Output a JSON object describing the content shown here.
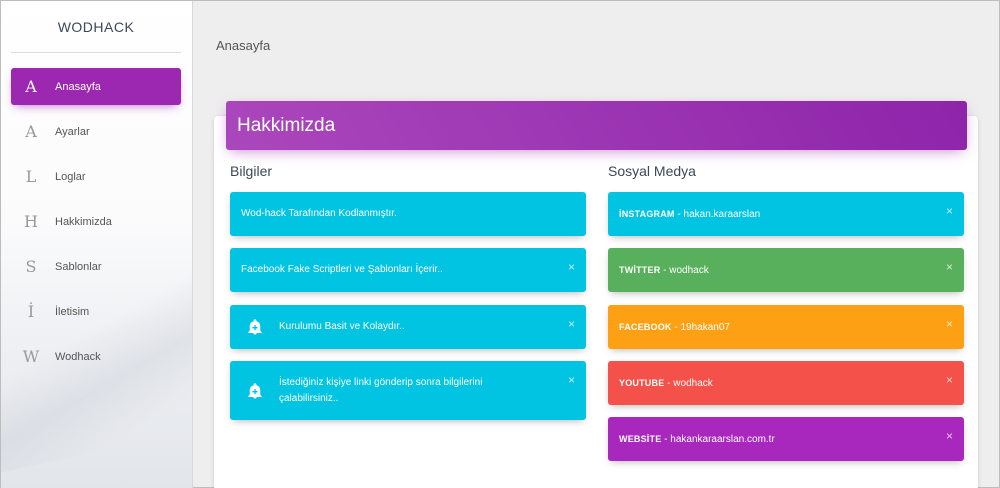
{
  "sidebar": {
    "logo": "WODHACK",
    "items": [
      {
        "mini": "A",
        "label": "Anasayfa",
        "active": true
      },
      {
        "mini": "A",
        "label": "Ayarlar"
      },
      {
        "mini": "L",
        "label": "Loglar"
      },
      {
        "mini": "H",
        "label": "Hakkimizda"
      },
      {
        "mini": "S",
        "label": "Sablonlar"
      },
      {
        "mini": "İ",
        "label": "İletisim"
      },
      {
        "mini": "W",
        "label": "Wodhack"
      }
    ]
  },
  "header": {
    "title": "Anasayfa"
  },
  "card": {
    "title": "Hakkimizda",
    "left": {
      "title": "Bilgiler",
      "alerts": [
        {
          "text": "Wod-hack Tarafından Kodlanmıştır."
        },
        {
          "text": "Facebook Fake Scriptleri ve Şablonları İçerir..",
          "close": "×"
        },
        {
          "text": "Kurulumu Basit ve Kolaydır..",
          "close": "×",
          "icon": "bell-plus-icon"
        },
        {
          "text": "İstediğiniz kişiye linki gönderip sonra bilgilerini çalabilirsiniz..",
          "close": "×",
          "icon": "bell-plus-icon"
        }
      ]
    },
    "right": {
      "title": "Sosyal Medya",
      "alerts": [
        {
          "label": "İNSTAGRAM",
          "value": " - hakan.karaarslan",
          "close": "×",
          "color": "#00c4e2"
        },
        {
          "label": "TWİTTER",
          "value": " - wodhack",
          "close": "×",
          "color": "#58b05c"
        },
        {
          "label": "FACEBOOK",
          "value": " - 19hakan07",
          "close": "×",
          "color": "#fea013"
        },
        {
          "label": "YOUTUBE",
          "value": " - wodhack",
          "close": "×",
          "color": "#f4514a"
        },
        {
          "label": "WEBSİTE",
          "value": " - hakankaraarslan.com.tr",
          "close": "×",
          "color": "#a828bd"
        }
      ]
    }
  }
}
